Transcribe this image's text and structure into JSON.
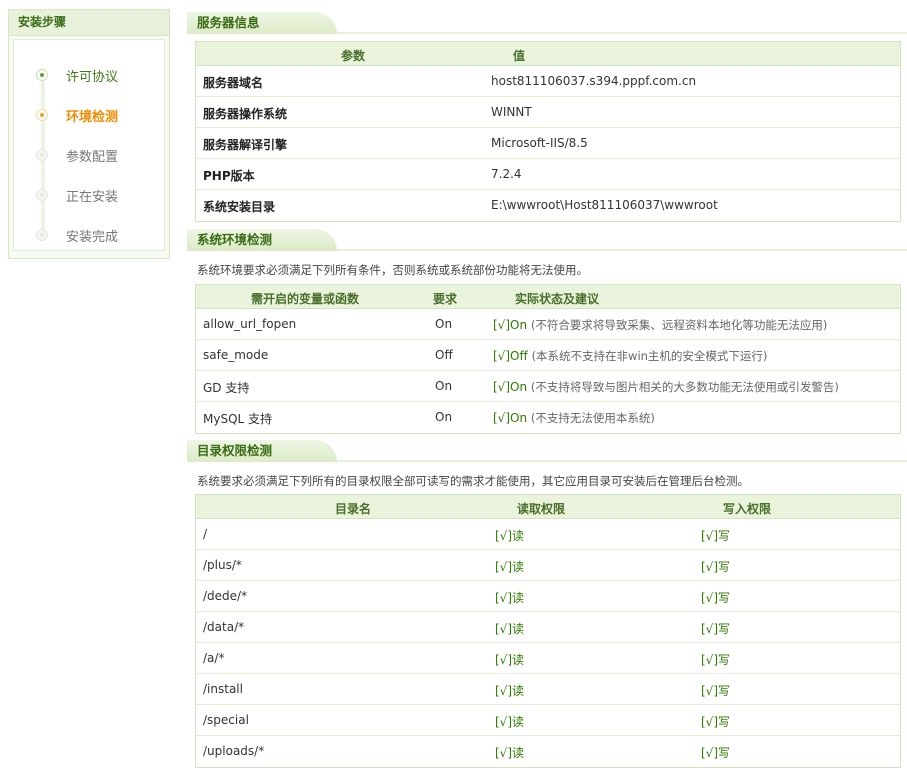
{
  "sidebar": {
    "title": "安装步骤",
    "steps": [
      {
        "label": "许可协议",
        "state": "done"
      },
      {
        "label": "环境检测",
        "state": "current"
      },
      {
        "label": "参数配置",
        "state": "pending"
      },
      {
        "label": "正在安装",
        "state": "pending"
      },
      {
        "label": "安装完成",
        "state": "pending"
      }
    ]
  },
  "server": {
    "title": "服务器信息",
    "col_param": "参数",
    "col_value": "值",
    "rows": [
      {
        "k": "服务器域名",
        "v": "host811106037.s394.pppf.com.cn"
      },
      {
        "k": "服务器操作系统",
        "v": "WINNT"
      },
      {
        "k": "服务器解译引擎",
        "v": "Microsoft-IIS/8.5"
      },
      {
        "k": "PHP版本",
        "v": "7.2.4"
      },
      {
        "k": "系统安装目录",
        "v": "E:\\wwwroot\\Host811106037\\wwwroot"
      }
    ]
  },
  "env": {
    "title": "系统环境检测",
    "desc": "系统环境要求必须满足下列所有条件，否则系统或系统部份功能将无法使用。",
    "col_name": "需开启的变量或函数",
    "col_req": "要求",
    "col_status": "实际状态及建议",
    "rows": [
      {
        "name": "allow_url_fopen",
        "req": "On",
        "status": "[√]On",
        "note": "(不符合要求将导致采集、远程资料本地化等功能无法应用)"
      },
      {
        "name": "safe_mode",
        "req": "Off",
        "status": "[√]Off",
        "note": "(本系统不支持在非win主机的安全模式下运行)"
      },
      {
        "name": "GD 支持",
        "req": "On",
        "status": "[√]On",
        "note": "(不支持将导致与图片相关的大多数功能无法使用或引发警告)"
      },
      {
        "name": "MySQL 支持",
        "req": "On",
        "status": "[√]On",
        "note": "(不支持无法使用本系统)"
      }
    ]
  },
  "dirs": {
    "title": "目录权限检测",
    "desc": "系统要求必须满足下列所有的目录权限全部可读写的需求才能使用，其它应用目录可安装后在管理后台检测。",
    "col_dir": "目录名",
    "col_read": "读取权限",
    "col_write": "写入权限",
    "rows": [
      {
        "dir": "/",
        "read": "[√]读",
        "write": "[√]写"
      },
      {
        "dir": "/plus/*",
        "read": "[√]读",
        "write": "[√]写"
      },
      {
        "dir": "/dede/*",
        "read": "[√]读",
        "write": "[√]写"
      },
      {
        "dir": "/data/*",
        "read": "[√]读",
        "write": "[√]写"
      },
      {
        "dir": "/a/*",
        "read": "[√]读",
        "write": "[√]写"
      },
      {
        "dir": "/install",
        "read": "[√]读",
        "write": "[√]写"
      },
      {
        "dir": "/special",
        "read": "[√]读",
        "write": "[√]写"
      },
      {
        "dir": "/uploads/*",
        "read": "[√]读",
        "write": "[√]写"
      }
    ]
  }
}
